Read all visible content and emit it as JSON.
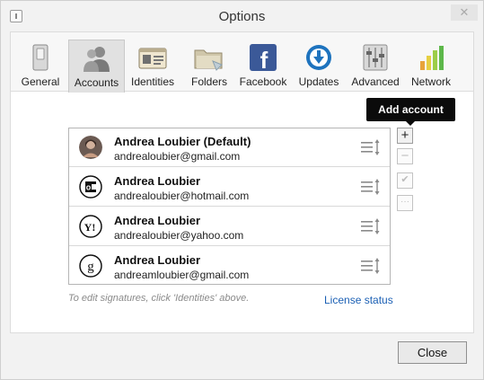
{
  "window": {
    "title": "Options"
  },
  "toolbar": {
    "tabs": [
      {
        "label": "General",
        "icon": "switch-icon"
      },
      {
        "label": "Accounts",
        "icon": "users-icon",
        "active": true
      },
      {
        "label": "Identities",
        "icon": "id-card-icon"
      },
      {
        "label": "Folders",
        "icon": "folder-icon"
      },
      {
        "label": "Facebook",
        "icon": "facebook-icon"
      },
      {
        "label": "Updates",
        "icon": "download-icon"
      },
      {
        "label": "Advanced",
        "icon": "sliders-icon"
      },
      {
        "label": "Network",
        "icon": "signal-bars-icon"
      }
    ]
  },
  "tooltip": {
    "text": "Add account"
  },
  "accounts": [
    {
      "name": "Andrea Loubier (Default)",
      "email": "andrealoubier@gmail.com",
      "icon": "avatar-icon"
    },
    {
      "name": "Andrea Loubier",
      "email": "andrealoubier@hotmail.com",
      "icon": "outlook-icon"
    },
    {
      "name": "Andrea Loubier",
      "email": "andrealoubier@yahoo.com",
      "icon": "yahoo-icon"
    },
    {
      "name": "Andrea Loubier",
      "email": "andreamloubier@gmail.com",
      "icon": "google-icon"
    }
  ],
  "side_buttons": {
    "add": "+",
    "remove": "−",
    "check": "✔",
    "more": "···"
  },
  "hint": "To edit signatures, click 'Identities' above.",
  "license_link": "License status",
  "footer": {
    "close_label": "Close"
  },
  "colors": {
    "accent": "#1a5fb4",
    "facebook": "#3b5998",
    "updates": "#1e73be"
  }
}
